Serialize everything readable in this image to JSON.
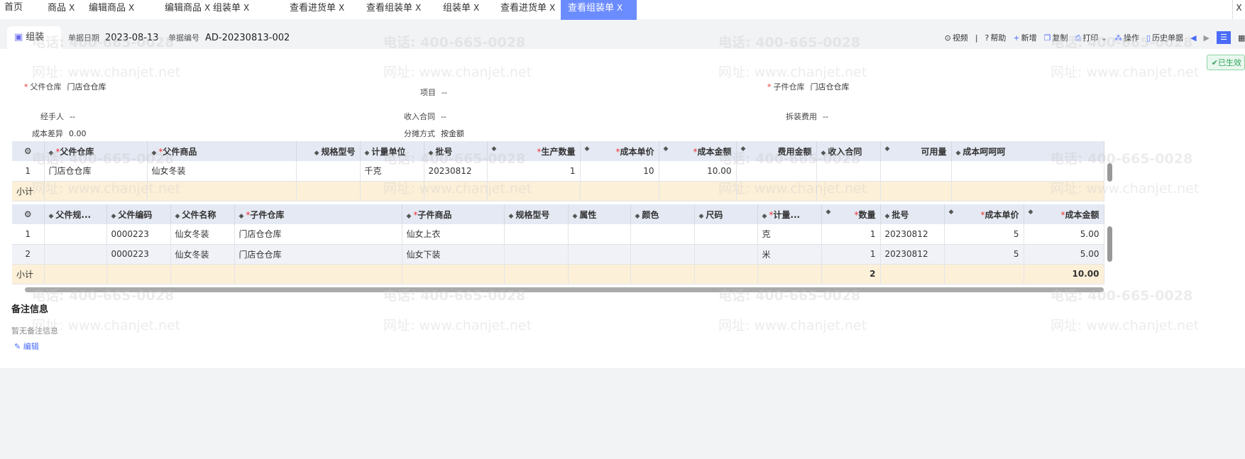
{
  "tabs": [
    {
      "label": "首页"
    },
    {
      "label": "商品"
    },
    {
      "label": "编辑商品"
    },
    {
      "label": "编辑商品"
    },
    {
      "label": "组装单"
    },
    {
      "label": "查看进货单"
    },
    {
      "label": "查看组装单"
    },
    {
      "label": "组装单"
    },
    {
      "label": "查看进货单"
    },
    {
      "label": "查看组装单",
      "active": true
    }
  ],
  "close_glyph": "X",
  "toolbar": {
    "title": "组装",
    "date_label": "单据日期",
    "date": "2023-08-13",
    "no_label": "单据编号",
    "no": "AD-20230813-002",
    "actions": [
      {
        "icon": "play-icon",
        "glyph": "⊙",
        "label": "视频"
      },
      {
        "icon": "help-icon",
        "glyph": "?",
        "label": "帮助"
      },
      {
        "icon": "plus-icon",
        "glyph": "+",
        "label": "新增"
      },
      {
        "icon": "copy-icon",
        "glyph": "❐",
        "label": "复制"
      },
      {
        "icon": "print-icon",
        "glyph": "⎙",
        "label": "打印"
      },
      {
        "icon": "operate-icon",
        "glyph": "⁂",
        "label": "操作"
      },
      {
        "icon": "history-icon",
        "glyph": "▯",
        "label": "历史单据"
      }
    ]
  },
  "status": "已生效",
  "form": {
    "parent_wh_label": "父件仓库",
    "parent_wh": "门店仓仓库",
    "project_label": "项目",
    "project": "--",
    "child_wh_label": "子件仓库",
    "child_wh": "门店仓仓库",
    "handler_label": "经手人",
    "handler": "--",
    "contract_label": "收入合同",
    "contract": "--",
    "fee_label": "拆装费用",
    "fee": "--",
    "diff_label": "成本差异",
    "diff": "0.00",
    "alloc_label": "分摊方式",
    "alloc": "按金额"
  },
  "table1": {
    "headers": [
      "父件仓库",
      "父件商品",
      "规格型号",
      "计量单位",
      "批号",
      "生产数量",
      "成本单价",
      "成本金额",
      "费用金额",
      "收入合同",
      "可用量",
      "成本呵呵呵"
    ],
    "rows": [
      [
        "1",
        "门店仓仓库",
        "仙女冬装",
        "",
        "千克",
        "20230812",
        "1",
        "10",
        "10.00",
        "",
        "",
        "",
        ""
      ]
    ],
    "subtotal_label": "小计"
  },
  "table2": {
    "headers": [
      "父件规...",
      "父件编码",
      "父件名称",
      "子件仓库",
      "子件商品",
      "规格型号",
      "属性",
      "颜色",
      "尺码",
      "计量...",
      "数量",
      "批号",
      "成本单价",
      "成本金额"
    ],
    "rows": [
      [
        "1",
        "",
        "0000223",
        "仙女冬装",
        "门店仓仓库",
        "仙女上衣",
        "",
        "",
        "",
        "",
        "克",
        "1",
        "20230812",
        "5",
        "5.00"
      ],
      [
        "2",
        "",
        "0000223",
        "仙女冬装",
        "门店仓仓库",
        "仙女下装",
        "",
        "",
        "",
        "",
        "米",
        "1",
        "20230812",
        "5",
        "5.00"
      ]
    ],
    "subtotal_label": "小计",
    "subtotal_qty": "2",
    "subtotal_amount": "10.00"
  },
  "notes": {
    "title": "备注信息",
    "empty": "暂无备注信息",
    "edit": "编辑"
  },
  "watermark": {
    "phone": "电话: 400-665-0028",
    "site": "网址: www.chanjet.net"
  }
}
